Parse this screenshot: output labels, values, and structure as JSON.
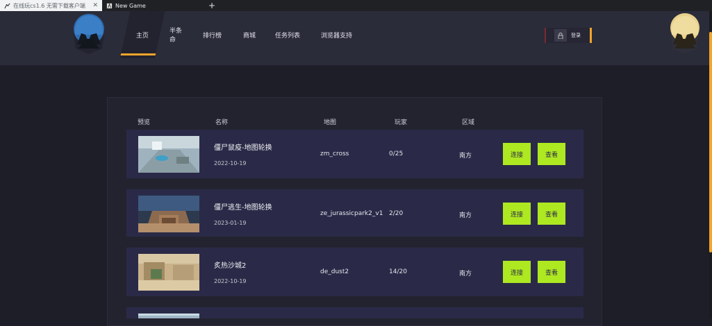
{
  "browser": {
    "tabs": [
      {
        "title": "在线玩cs1.6 无需下载客户端",
        "active": true
      },
      {
        "title": "New Game",
        "active": false
      }
    ],
    "new_tab_symbol": "+",
    "close_symbol": "✕"
  },
  "nav": {
    "items": [
      "主页",
      "半条命",
      "排行榜",
      "商城",
      "任务列表",
      "浏览器支持"
    ],
    "active_index": 0,
    "login_label": "登录",
    "lock_icon": "lock-icon"
  },
  "table": {
    "columns": [
      "预览",
      "名称",
      "地图",
      "玩家",
      "区域"
    ],
    "rows": [
      {
        "name": "僵尸鼠疫-地图轮换",
        "date": "2022-10-19",
        "map": "zm_cross",
        "players": "0/25",
        "region": "南方",
        "connect": "连接",
        "view": "查看"
      },
      {
        "name": "僵尸逃生-地图轮换",
        "date": "2023-01-19",
        "map": "ze_jurassicpark2_v1",
        "players": "2/20",
        "region": "南方",
        "connect": "连接",
        "view": "查看"
      },
      {
        "name": "炙热沙城2",
        "date": "2022-10-19",
        "map": "de_dust2",
        "players": "14/20",
        "region": "南方",
        "connect": "连接",
        "view": "查看"
      }
    ]
  },
  "colors": {
    "accent": "#f1a52a",
    "button": "#aee821",
    "row_bg": "#2a2a48",
    "page_bg": "#1d1e27"
  }
}
